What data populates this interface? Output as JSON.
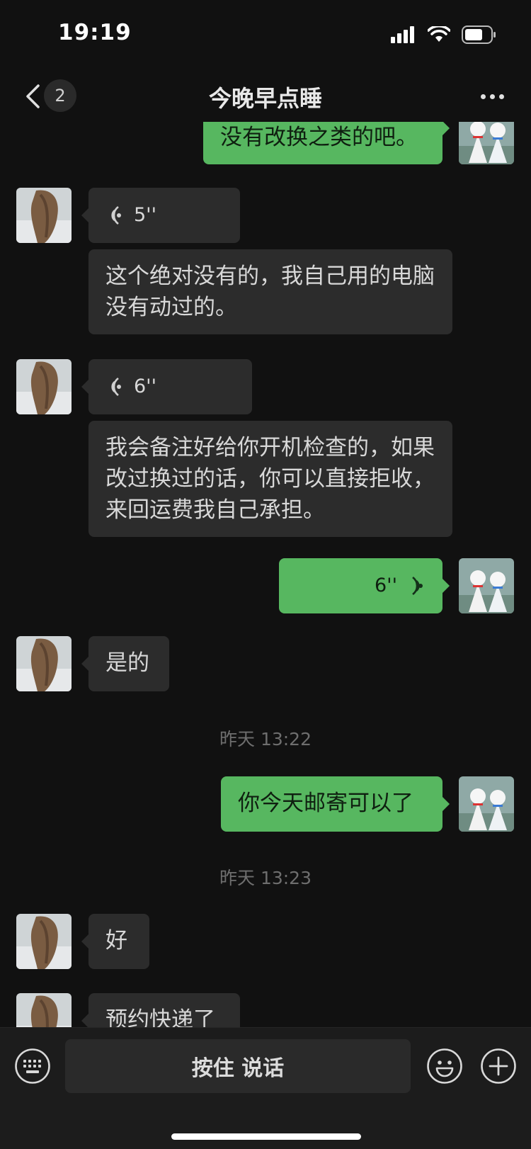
{
  "status_bar": {
    "time": "19:19"
  },
  "nav": {
    "badge": "2",
    "title": "今晚早点睡"
  },
  "messages": {
    "m0": "没有改换之类的吧。",
    "m1_voice": "5''",
    "m2": "这个绝对没有的，我自己用的电脑没有动过的。",
    "m3_voice": "6''",
    "m4": "我会备注好给你开机检查的，如果改过换过的话，你可以直接拒收，来回运费我自己承担。",
    "m5_voice": "6''",
    "m6": "是的",
    "ts1": "昨天 13:22",
    "m7": "你今天邮寄可以了",
    "ts2": "昨天 13:23",
    "m8": "好",
    "m9": "预约快递了"
  },
  "input_bar": {
    "hold_to_talk": "按住 说话"
  },
  "icons": {
    "back": "chevron-left-icon",
    "more": "more-icon",
    "keyboard": "keyboard-icon",
    "emoji": "emoji-icon",
    "plus": "plus-icon",
    "voice": "voice-wave-icon"
  },
  "colors": {
    "background": "#111111",
    "incoming_bubble": "#2c2c2c",
    "outgoing_bubble": "#57b760",
    "timestamp": "#6e6e6e"
  }
}
